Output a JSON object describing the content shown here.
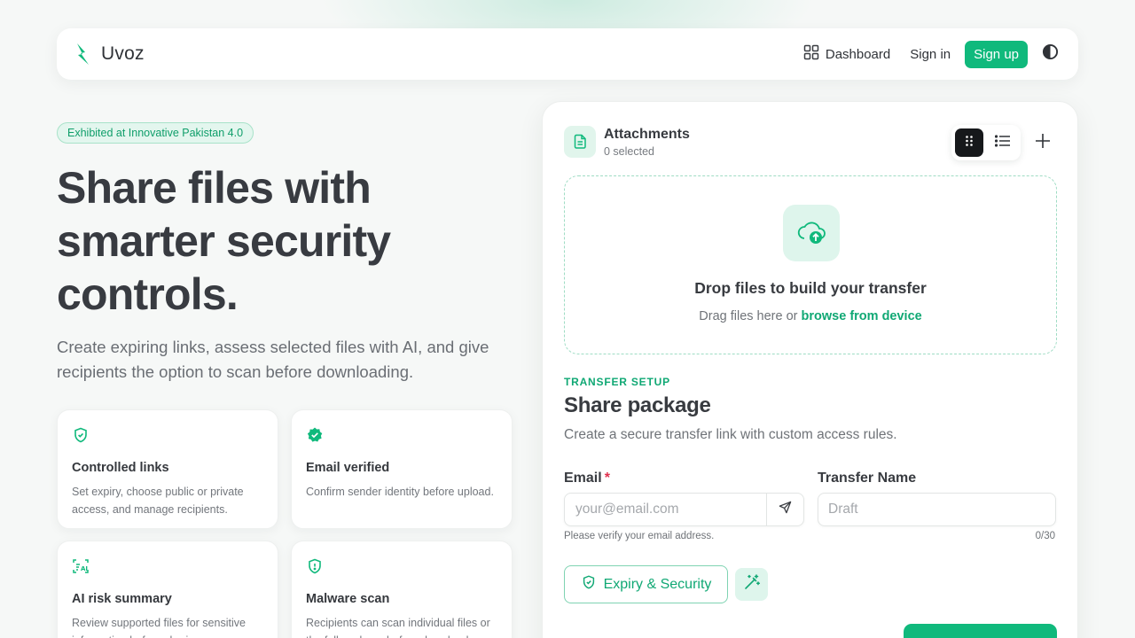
{
  "nav": {
    "brand": "Uvoz",
    "dashboard": "Dashboard",
    "sign_in": "Sign in",
    "sign_up": "Sign up"
  },
  "hero": {
    "badge": "Exhibited at Innovative Pakistan 4.0",
    "title_lines": [
      "Share files with",
      "smarter security",
      "controls."
    ],
    "subtitle": "Create expiring links, assess selected files with AI, and give recipients the option to scan before downloading."
  },
  "features": [
    {
      "icon": "shield-icon",
      "title": "Controlled links",
      "desc": "Set expiry, choose public or private access, and manage recipients."
    },
    {
      "icon": "verified-badge-icon",
      "title": "Email verified",
      "desc": "Confirm sender identity before upload."
    },
    {
      "icon": "ai-scan-icon",
      "title": "AI risk summary",
      "desc": "Review supported files for sensitive information before sharing."
    },
    {
      "icon": "shield-icon",
      "title": "Malware scan",
      "desc": "Recipients can scan individual files or the full package before download."
    }
  ],
  "attachments": {
    "title": "Attachments",
    "count": "0 selected"
  },
  "dropzone": {
    "title": "Drop files to build your transfer",
    "sub_prefix": "Drag files here or ",
    "link": "browse from device"
  },
  "setup": {
    "label": "TRANSFER SETUP",
    "title": "Share package",
    "subtitle": "Create a secure transfer link with custom access rules.",
    "email_label": "Email",
    "email_required": "*",
    "email_placeholder": "your@email.com",
    "email_helper": "Please verify your email address.",
    "name_label": "Transfer Name",
    "name_placeholder": "Draft",
    "name_counter": "0/30",
    "security_button": "Expiry & Security"
  },
  "colors": {
    "accent": "#10b97c",
    "accent_text": "#10a874",
    "required": "#e0314e"
  }
}
